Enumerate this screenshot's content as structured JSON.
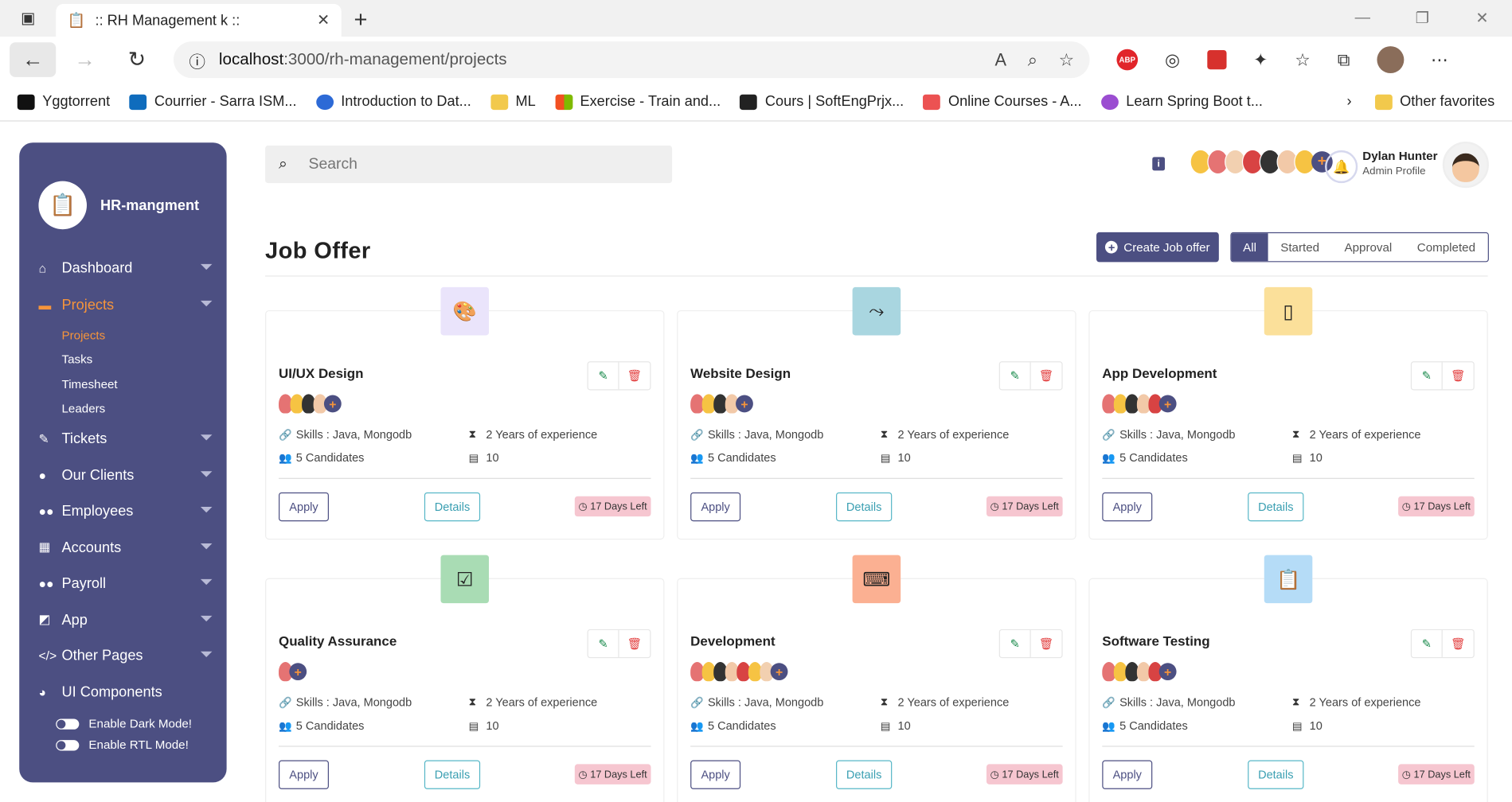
{
  "browser": {
    "tab_title": ":: RH Management k ::",
    "url_host": "localhost",
    "url_path": ":3000/rh-management/projects",
    "bookmarks": [
      "Yggtorrent",
      "Courrier - Sarra ISM...",
      "Introduction to Dat...",
      "ML",
      "Exercise - Train and...",
      "Cours | SoftEngPrjx...",
      "Online Courses - A...",
      "Learn Spring Boot t..."
    ],
    "other_favorites": "Other favorites"
  },
  "sidebar": {
    "brand": "HR-mangment",
    "items": [
      {
        "label": "Dashboard"
      },
      {
        "label": "Projects"
      },
      {
        "label": "Tickets"
      },
      {
        "label": "Our Clients"
      },
      {
        "label": "Employees"
      },
      {
        "label": "Accounts"
      },
      {
        "label": "Payroll"
      },
      {
        "label": "App"
      },
      {
        "label": "Other Pages"
      },
      {
        "label": "UI Components"
      }
    ],
    "projects_sub": [
      "Projects",
      "Tasks",
      "Timesheet",
      "Leaders"
    ],
    "dark_mode": "Enable Dark Mode!",
    "rtl_mode": "Enable RTL Mode!"
  },
  "header": {
    "search_placeholder": "Search",
    "user_name": "Dylan Hunter",
    "user_role": "Admin Profile"
  },
  "page": {
    "title": "Job Offer",
    "create_label": "Create Job offer",
    "filters": [
      "All",
      "Started",
      "Approval",
      "Completed"
    ]
  },
  "cards": [
    {
      "title": "UI/UX Design",
      "skills": "Skills : Java, Mongodb",
      "experience": "2 Years of experience",
      "candidates": "5 Candidates",
      "count": "10",
      "apply": "Apply",
      "details": "Details",
      "days": "17 Days Left",
      "icon_color": "#eae4fb",
      "icon": "palette-icon"
    },
    {
      "title": "Website Design",
      "skills": "Skills : Java, Mongodb",
      "experience": "2 Years of experience",
      "candidates": "5 Candidates",
      "count": "10",
      "apply": "Apply",
      "details": "Details",
      "days": "17 Days Left",
      "icon_color": "#a9d6e0",
      "icon": "bezier-icon"
    },
    {
      "title": "App Development",
      "skills": "Skills : Java, Mongodb",
      "experience": "2 Years of experience",
      "candidates": "5 Candidates",
      "count": "10",
      "apply": "Apply",
      "details": "Details",
      "days": "17 Days Left",
      "icon_color": "#fbe09a",
      "icon": "phone-icon"
    },
    {
      "title": "Quality Assurance",
      "skills": "Skills : Java, Mongodb",
      "experience": "2 Years of experience",
      "candidates": "5 Candidates",
      "count": "10",
      "apply": "Apply",
      "details": "Details",
      "days": "17 Days Left",
      "icon_color": "#a9dcb4",
      "icon": "checkbox-icon"
    },
    {
      "title": "Development",
      "skills": "Skills : Java, Mongodb",
      "experience": "2 Years of experience",
      "candidates": "5 Candidates",
      "count": "10",
      "apply": "Apply",
      "details": "Details",
      "days": "17 Days Left",
      "icon_color": "#fbb092",
      "icon": "code-window-icon"
    },
    {
      "title": "Software Testing",
      "skills": "Skills : Java, Mongodb",
      "experience": "2 Years of experience",
      "candidates": "5 Candidates",
      "count": "10",
      "apply": "Apply",
      "details": "Details",
      "days": "17 Days Left",
      "icon_color": "#b5dcf7",
      "icon": "clipboard-icon"
    }
  ]
}
